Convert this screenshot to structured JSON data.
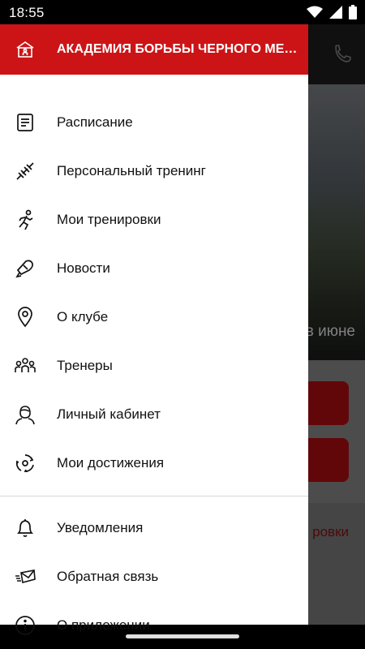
{
  "status_bar": {
    "time": "18:55"
  },
  "drawer": {
    "header_title": "АКАДЕМИЯ БОРЬБЫ ЧЕРНОГО МЕДВЕДЯ",
    "items_main": [
      {
        "label": "Расписание",
        "icon": "schedule-icon"
      },
      {
        "label": "Персональный тренинг",
        "icon": "dumbbell-icon"
      },
      {
        "label": "Мои тренировки",
        "icon": "running-person-icon"
      },
      {
        "label": "Новости",
        "icon": "megaphone-icon"
      },
      {
        "label": "О клубе",
        "icon": "location-pin-icon"
      },
      {
        "label": "Тренеры",
        "icon": "people-icon"
      },
      {
        "label": "Личный кабинет",
        "icon": "user-profile-icon"
      },
      {
        "label": "Мои достижения",
        "icon": "achievement-icon"
      }
    ],
    "items_secondary": [
      {
        "label": "Уведомления",
        "icon": "bell-icon"
      },
      {
        "label": "Обратная связь",
        "icon": "feedback-envelope-icon"
      },
      {
        "label": "О приложении",
        "icon": "info-icon"
      }
    ]
  },
  "background_app": {
    "hero_caption_fragment": "в июне",
    "link_fragment": "ровки"
  },
  "colors": {
    "accent": "#cc1417",
    "text": "#111111"
  }
}
